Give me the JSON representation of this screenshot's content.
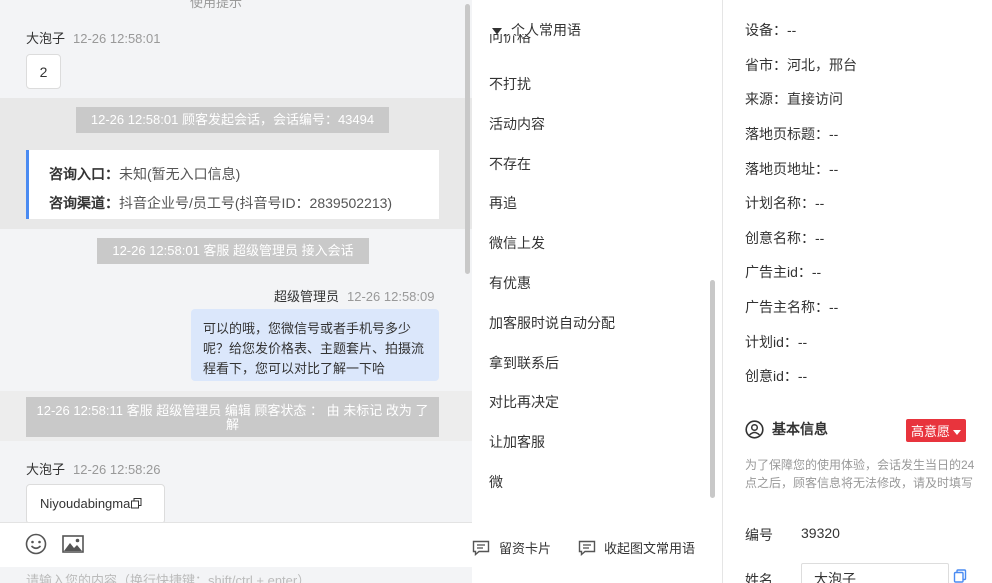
{
  "chat": {
    "cut_top": "使用提示",
    "msg1": {
      "sender": "大泡子",
      "time": "12-26 12:58:01",
      "text": "2"
    },
    "sys1": "12-26 12:58:01 顾客发起会话，会话编号：43494",
    "consult": {
      "entry_label": "咨询入口：",
      "entry_value": "未知(暂无入口信息)",
      "channel_label": "咨询渠道：",
      "channel_value": "抖音企业号/员工号(抖音号ID：2839502213)"
    },
    "sys2": "12-26 12:58:01 客服 超级管理员 接入会话",
    "msg2": {
      "sender": "超级管理员",
      "time": "12-26 12:58:09",
      "text": "可以的哦，您微信号或者手机号多少呢？给您发价格表、主题套片、拍摄流程看下，您可以对比了解一下哈"
    },
    "sys3": "12-26 12:58:11 客服 超级管理员 编辑 顾客状态 ： 由 未标记 改为 了解",
    "msg3": {
      "sender": "大泡子",
      "time": "12-26 12:58:26",
      "text": "Niyoudabingma"
    },
    "input_placeholder": "请输入您的内容（换行快捷键：shift/ctrl + enter）"
  },
  "phrases": {
    "header": "个人常用语",
    "cut_item": "问价格",
    "items": [
      "不打扰",
      "活动内容",
      "不存在",
      "再追",
      "微信上发",
      "有优惠",
      "加客服时说自动分配",
      "拿到联系后",
      "对比再决定",
      "让加客服",
      "微"
    ],
    "card_button": "留资卡片",
    "collapse_button": "收起图文常用语"
  },
  "info": {
    "rows": [
      "设备：--",
      "省市：河北，邢台",
      "来源：直接访问",
      "落地页标题：--",
      "落地页地址：--",
      "计划名称：--",
      "创意名称：--",
      "广告主id：--",
      "广告主名称：--",
      "计划id：--",
      "创意id：--"
    ],
    "basic_title": "基本信息",
    "intent_tag": "高意愿",
    "notice": "为了保障您的使用体验，会话发生当日的24点之后，顾客信息将无法修改，请及时填写",
    "id_label": "编号",
    "id_value": "39320",
    "name_label": "姓名",
    "name_value": "大泡子"
  },
  "colors": {
    "accent": "#4a8bf2",
    "tag_red": "#e8343d",
    "agent_bubble": "#dbe7fb"
  }
}
